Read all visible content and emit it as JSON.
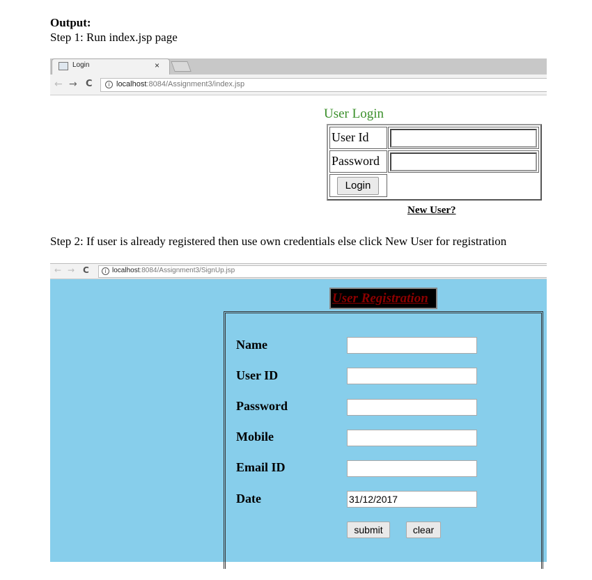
{
  "document": {
    "heading": "Output:",
    "step1": "Step 1: Run index.jsp page",
    "step2": "Step 2: If user is already registered then use own credentials else click New User for registration"
  },
  "browser1": {
    "tab_title": "Login",
    "tab_close": "×",
    "url_host": "localhost",
    "url_path": ":8084/Assignment3/index.jsp",
    "nav_back": "←",
    "nav_forward": "→",
    "nav_reload": "C",
    "info": "i"
  },
  "login": {
    "title": "User Login",
    "userid_label": "User Id",
    "password_label": "Password",
    "userid_value": "",
    "password_value": "",
    "login_button": "Login",
    "new_user_link": "New User?"
  },
  "browser2": {
    "url_host": "localhost",
    "url_path": ":8084/Assignment3/SignUp.jsp",
    "nav_back": "←",
    "nav_forward": "→",
    "nav_reload": "C",
    "info": "i"
  },
  "registration": {
    "title": "User Registration",
    "fields": [
      {
        "label": "Name",
        "value": ""
      },
      {
        "label": "User ID",
        "value": ""
      },
      {
        "label": "Password",
        "value": ""
      },
      {
        "label": "Mobile",
        "value": ""
      },
      {
        "label": "Email ID",
        "value": ""
      },
      {
        "label": "Date",
        "value": "31/12/2017"
      }
    ],
    "submit_button": "submit",
    "clear_button": "clear"
  },
  "colors": {
    "login_title": "#3a8f2a",
    "signup_background": "#87ceeb",
    "registration_title": "#8b0000"
  }
}
